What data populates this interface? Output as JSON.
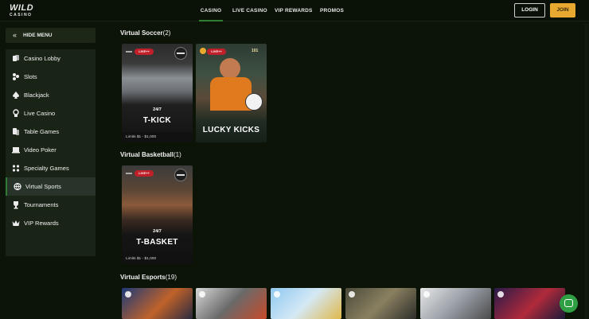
{
  "brand": {
    "logo_top": "WILD",
    "logo_bottom": "CASINO"
  },
  "topnav": {
    "items": [
      {
        "label": "CASINO",
        "active": true
      },
      {
        "label": "LIVE CASINO",
        "active": false
      },
      {
        "label": "VIP REWARDS",
        "active": false
      },
      {
        "label": "PROMOS",
        "active": false
      }
    ],
    "login_label": "LOGIN",
    "join_label": "JOIN",
    "accent_color": "#2e7d32",
    "join_color": "#e7a92f"
  },
  "sidebar": {
    "hide_label": "HIDE MENU",
    "items": [
      {
        "label": "Casino Lobby",
        "icon": "cards-icon",
        "active": false
      },
      {
        "label": "Slots",
        "icon": "slots-icon",
        "active": false
      },
      {
        "label": "Blackjack",
        "icon": "spade-icon",
        "active": false
      },
      {
        "label": "Live Casino",
        "icon": "dealer-icon",
        "active": false
      },
      {
        "label": "Table Games",
        "icon": "table-icon",
        "active": false
      },
      {
        "label": "Video Poker",
        "icon": "monitor-icon",
        "active": false
      },
      {
        "label": "Specialty Games",
        "icon": "dice-icon",
        "active": false
      },
      {
        "label": "Virtual Sports",
        "icon": "ball-icon",
        "active": true
      },
      {
        "label": "Tournaments",
        "icon": "trophy-icon",
        "active": false
      },
      {
        "label": "VIP Rewards",
        "icon": "crown-icon",
        "active": false
      }
    ]
  },
  "sections": {
    "soccer": {
      "title": "Virtual Soccer",
      "count": "(2)"
    },
    "basketball": {
      "title": "Virtual Basketball",
      "count": "(1)"
    },
    "esports": {
      "title": "Virtual Esports",
      "count": "(19)"
    }
  },
  "games": {
    "tkick": {
      "badge": "LIVE++",
      "sub": "24/7",
      "name": "T-KICK",
      "limits": "Limits $1 - $1,000"
    },
    "lucky": {
      "badge": "LIVE++",
      "name": "LUCKY KICKS",
      "provider": "101"
    },
    "tbasket": {
      "badge": "LIVE++",
      "sub": "24/7",
      "name": "T-BASKET",
      "limits": "Limits $1 - $1,000"
    }
  },
  "esports_thumbs": [
    "esports-thumb",
    "esports-thumb",
    "esports-thumb",
    "esports-thumb",
    "esports-thumb",
    "esports-thumb"
  ]
}
